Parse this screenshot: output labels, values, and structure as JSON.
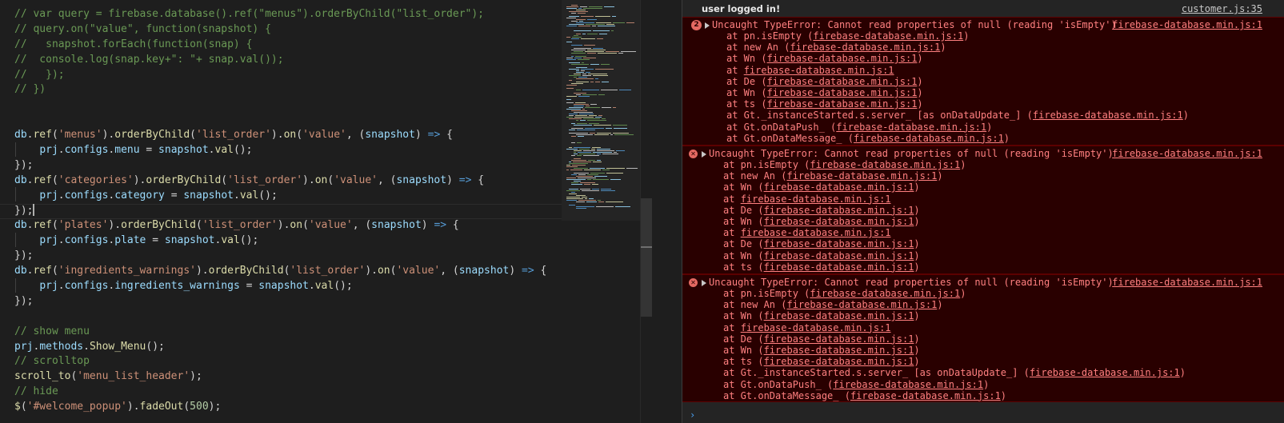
{
  "editor": {
    "lines": [
      [
        {
          "c": "cmt",
          "t": "// var query = firebase.database().ref(\"menus\").orderByChild(\"list_order\");"
        }
      ],
      [
        {
          "c": "cmt",
          "t": "// query.on(\"value\", function(snapshot) {"
        }
      ],
      [
        {
          "c": "cmt",
          "t": "//   snapshot.forEach(function(snap) {"
        }
      ],
      [
        {
          "c": "cmt",
          "t": "//  console.log(snap.key+\": \"+ snap.val());"
        }
      ],
      [
        {
          "c": "cmt",
          "t": "//   });"
        }
      ],
      [
        {
          "c": "cmt",
          "t": "// })"
        }
      ],
      [],
      [],
      [
        {
          "c": "vr",
          "t": "db"
        },
        {
          "c": "pl",
          "t": "."
        },
        {
          "c": "fn",
          "t": "ref"
        },
        {
          "c": "pl",
          "t": "("
        },
        {
          "c": "str",
          "t": "'menus'"
        },
        {
          "c": "pl",
          "t": ")."
        },
        {
          "c": "fn",
          "t": "orderByChild"
        },
        {
          "c": "pl",
          "t": "("
        },
        {
          "c": "str",
          "t": "'list_order'"
        },
        {
          "c": "pl",
          "t": ")."
        },
        {
          "c": "fn",
          "t": "on"
        },
        {
          "c": "pl",
          "t": "("
        },
        {
          "c": "str",
          "t": "'value'"
        },
        {
          "c": "pl",
          "t": ", ("
        },
        {
          "c": "vr",
          "t": "snapshot"
        },
        {
          "c": "pl",
          "t": ") "
        },
        {
          "c": "kw",
          "t": "=>"
        },
        {
          "c": "pl",
          "t": " {"
        }
      ],
      [
        {
          "c": "pl",
          "t": "    "
        },
        {
          "c": "vr",
          "t": "prj"
        },
        {
          "c": "pl",
          "t": "."
        },
        {
          "c": "vr",
          "t": "configs"
        },
        {
          "c": "pl",
          "t": "."
        },
        {
          "c": "vr",
          "t": "menu"
        },
        {
          "c": "pl",
          "t": " = "
        },
        {
          "c": "vr",
          "t": "snapshot"
        },
        {
          "c": "pl",
          "t": "."
        },
        {
          "c": "fn",
          "t": "val"
        },
        {
          "c": "pl",
          "t": "();"
        }
      ],
      [
        {
          "c": "pl",
          "t": "});"
        }
      ],
      [
        {
          "c": "vr",
          "t": "db"
        },
        {
          "c": "pl",
          "t": "."
        },
        {
          "c": "fn",
          "t": "ref"
        },
        {
          "c": "pl",
          "t": "("
        },
        {
          "c": "str",
          "t": "'categories'"
        },
        {
          "c": "pl",
          "t": ")."
        },
        {
          "c": "fn",
          "t": "orderByChild"
        },
        {
          "c": "pl",
          "t": "("
        },
        {
          "c": "str",
          "t": "'list_order'"
        },
        {
          "c": "pl",
          "t": ")."
        },
        {
          "c": "fn",
          "t": "on"
        },
        {
          "c": "pl",
          "t": "("
        },
        {
          "c": "str",
          "t": "'value'"
        },
        {
          "c": "pl",
          "t": ", ("
        },
        {
          "c": "vr",
          "t": "snapshot"
        },
        {
          "c": "pl",
          "t": ") "
        },
        {
          "c": "kw",
          "t": "=>"
        },
        {
          "c": "pl",
          "t": " {"
        }
      ],
      [
        {
          "c": "pl",
          "t": "    "
        },
        {
          "c": "vr",
          "t": "prj"
        },
        {
          "c": "pl",
          "t": "."
        },
        {
          "c": "vr",
          "t": "configs"
        },
        {
          "c": "pl",
          "t": "."
        },
        {
          "c": "vr",
          "t": "category"
        },
        {
          "c": "pl",
          "t": " = "
        },
        {
          "c": "vr",
          "t": "snapshot"
        },
        {
          "c": "pl",
          "t": "."
        },
        {
          "c": "fn",
          "t": "val"
        },
        {
          "c": "pl",
          "t": "();"
        }
      ],
      [
        {
          "c": "pl",
          "t": "});"
        }
      ],
      [
        {
          "c": "vr",
          "t": "db"
        },
        {
          "c": "pl",
          "t": "."
        },
        {
          "c": "fn",
          "t": "ref"
        },
        {
          "c": "pl",
          "t": "("
        },
        {
          "c": "str",
          "t": "'plates'"
        },
        {
          "c": "pl",
          "t": ")."
        },
        {
          "c": "fn",
          "t": "orderByChild"
        },
        {
          "c": "pl",
          "t": "("
        },
        {
          "c": "str",
          "t": "'list_order'"
        },
        {
          "c": "pl",
          "t": ")."
        },
        {
          "c": "fn",
          "t": "on"
        },
        {
          "c": "pl",
          "t": "("
        },
        {
          "c": "str",
          "t": "'value'"
        },
        {
          "c": "pl",
          "t": ", ("
        },
        {
          "c": "vr",
          "t": "snapshot"
        },
        {
          "c": "pl",
          "t": ") "
        },
        {
          "c": "kw",
          "t": "=>"
        },
        {
          "c": "pl",
          "t": " {"
        }
      ],
      [
        {
          "c": "pl",
          "t": "    "
        },
        {
          "c": "vr",
          "t": "prj"
        },
        {
          "c": "pl",
          "t": "."
        },
        {
          "c": "vr",
          "t": "configs"
        },
        {
          "c": "pl",
          "t": "."
        },
        {
          "c": "vr",
          "t": "plate"
        },
        {
          "c": "pl",
          "t": " = "
        },
        {
          "c": "vr",
          "t": "snapshot"
        },
        {
          "c": "pl",
          "t": "."
        },
        {
          "c": "fn",
          "t": "val"
        },
        {
          "c": "pl",
          "t": "();"
        }
      ],
      [
        {
          "c": "pl",
          "t": "});"
        }
      ],
      [
        {
          "c": "vr",
          "t": "db"
        },
        {
          "c": "pl",
          "t": "."
        },
        {
          "c": "fn",
          "t": "ref"
        },
        {
          "c": "pl",
          "t": "("
        },
        {
          "c": "str",
          "t": "'ingredients_warnings'"
        },
        {
          "c": "pl",
          "t": ")."
        },
        {
          "c": "fn",
          "t": "orderByChild"
        },
        {
          "c": "pl",
          "t": "("
        },
        {
          "c": "str",
          "t": "'list_order'"
        },
        {
          "c": "pl",
          "t": ")."
        },
        {
          "c": "fn",
          "t": "on"
        },
        {
          "c": "pl",
          "t": "("
        },
        {
          "c": "str",
          "t": "'value'"
        },
        {
          "c": "pl",
          "t": ", ("
        },
        {
          "c": "vr",
          "t": "snapshot"
        },
        {
          "c": "pl",
          "t": ") "
        },
        {
          "c": "kw",
          "t": "=>"
        },
        {
          "c": "pl",
          "t": " {"
        }
      ],
      [
        {
          "c": "pl",
          "t": "    "
        },
        {
          "c": "vr",
          "t": "prj"
        },
        {
          "c": "pl",
          "t": "."
        },
        {
          "c": "vr",
          "t": "configs"
        },
        {
          "c": "pl",
          "t": "."
        },
        {
          "c": "vr",
          "t": "ingredients_warnings"
        },
        {
          "c": "pl",
          "t": " = "
        },
        {
          "c": "vr",
          "t": "snapshot"
        },
        {
          "c": "pl",
          "t": "."
        },
        {
          "c": "fn",
          "t": "val"
        },
        {
          "c": "pl",
          "t": "();"
        }
      ],
      [
        {
          "c": "pl",
          "t": "});"
        }
      ],
      [],
      [
        {
          "c": "cmt",
          "t": "// show menu"
        }
      ],
      [
        {
          "c": "vr",
          "t": "prj"
        },
        {
          "c": "pl",
          "t": "."
        },
        {
          "c": "vr",
          "t": "methods"
        },
        {
          "c": "pl",
          "t": "."
        },
        {
          "c": "fn",
          "t": "Show_Menu"
        },
        {
          "c": "pl",
          "t": "();"
        }
      ],
      [
        {
          "c": "cmt",
          "t": "// scrolltop"
        }
      ],
      [
        {
          "c": "fn",
          "t": "scroll_to"
        },
        {
          "c": "pl",
          "t": "("
        },
        {
          "c": "str",
          "t": "'menu_list_header'"
        },
        {
          "c": "pl",
          "t": ");"
        }
      ],
      [
        {
          "c": "cmt",
          "t": "// hide"
        }
      ],
      [
        {
          "c": "fn",
          "t": "$"
        },
        {
          "c": "pl",
          "t": "("
        },
        {
          "c": "str",
          "t": "'#welcome_popup'"
        },
        {
          "c": "pl",
          "t": ")."
        },
        {
          "c": "fn",
          "t": "fadeOut"
        },
        {
          "c": "pl",
          "t": "("
        },
        {
          "c": "num",
          "t": "500"
        },
        {
          "c": "pl",
          "t": ");"
        }
      ]
    ]
  },
  "console": {
    "log": {
      "text": "user logged in!",
      "source": "customer.js:35"
    },
    "errors": [
      {
        "count": "2",
        "message": "Uncaught TypeError: Cannot read properties of null (reading 'isEmpty')",
        "source": "firebase-database.min.js:1",
        "frames": [
          {
            "pre": "at pn.isEmpty (",
            "link": "firebase-database.min.js:1",
            "post": ")"
          },
          {
            "pre": "at new An (",
            "link": "firebase-database.min.js:1",
            "post": ")"
          },
          {
            "pre": "at Wn (",
            "link": "firebase-database.min.js:1",
            "post": ")"
          },
          {
            "pre": "at ",
            "link": "firebase-database.min.js:1",
            "post": ""
          },
          {
            "pre": "at De (",
            "link": "firebase-database.min.js:1",
            "post": ")"
          },
          {
            "pre": "at Wn (",
            "link": "firebase-database.min.js:1",
            "post": ")"
          },
          {
            "pre": "at ts (",
            "link": "firebase-database.min.js:1",
            "post": ")"
          },
          {
            "pre": "at Gt._instanceStarted.s.server_ [as onDataUpdate_] (",
            "link": "firebase-database.min.js:1",
            "post": ")"
          },
          {
            "pre": "at Gt.onDataPush_ (",
            "link": "firebase-database.min.js:1",
            "post": ")"
          },
          {
            "pre": "at Gt.onDataMessage_ (",
            "link": "firebase-database.min.js:1",
            "post": ")"
          }
        ]
      },
      {
        "count": "",
        "message": "Uncaught TypeError: Cannot read properties of null (reading 'isEmpty')",
        "source": "firebase-database.min.js:1",
        "frames": [
          {
            "pre": "at pn.isEmpty (",
            "link": "firebase-database.min.js:1",
            "post": ")"
          },
          {
            "pre": "at new An (",
            "link": "firebase-database.min.js:1",
            "post": ")"
          },
          {
            "pre": "at Wn (",
            "link": "firebase-database.min.js:1",
            "post": ")"
          },
          {
            "pre": "at ",
            "link": "firebase-database.min.js:1",
            "post": ""
          },
          {
            "pre": "at De (",
            "link": "firebase-database.min.js:1",
            "post": ")"
          },
          {
            "pre": "at Wn (",
            "link": "firebase-database.min.js:1",
            "post": ")"
          },
          {
            "pre": "at ",
            "link": "firebase-database.min.js:1",
            "post": ""
          },
          {
            "pre": "at De (",
            "link": "firebase-database.min.js:1",
            "post": ")"
          },
          {
            "pre": "at Wn (",
            "link": "firebase-database.min.js:1",
            "post": ")"
          },
          {
            "pre": "at ts (",
            "link": "firebase-database.min.js:1",
            "post": ")"
          }
        ]
      },
      {
        "count": "",
        "message": "Uncaught TypeError: Cannot read properties of null (reading 'isEmpty')",
        "source": "firebase-database.min.js:1",
        "frames": [
          {
            "pre": "at pn.isEmpty (",
            "link": "firebase-database.min.js:1",
            "post": ")"
          },
          {
            "pre": "at new An (",
            "link": "firebase-database.min.js:1",
            "post": ")"
          },
          {
            "pre": "at Wn (",
            "link": "firebase-database.min.js:1",
            "post": ")"
          },
          {
            "pre": "at ",
            "link": "firebase-database.min.js:1",
            "post": ""
          },
          {
            "pre": "at De (",
            "link": "firebase-database.min.js:1",
            "post": ")"
          },
          {
            "pre": "at Wn (",
            "link": "firebase-database.min.js:1",
            "post": ")"
          },
          {
            "pre": "at ts (",
            "link": "firebase-database.min.js:1",
            "post": ")"
          },
          {
            "pre": "at Gt._instanceStarted.s.server_ [as onDataUpdate_] (",
            "link": "firebase-database.min.js:1",
            "post": ")"
          },
          {
            "pre": "at Gt.onDataPush_ (",
            "link": "firebase-database.min.js:1",
            "post": ")"
          },
          {
            "pre": "at Gt.onDataMessage_ (",
            "link": "firebase-database.min.js:1",
            "post": ")"
          }
        ]
      }
    ],
    "prompt": "›"
  },
  "colors": {
    "error_text": "#ff8080",
    "error_bg": "#290000",
    "console_bg": "#242424",
    "editor_bg": "#1e1e1e"
  }
}
